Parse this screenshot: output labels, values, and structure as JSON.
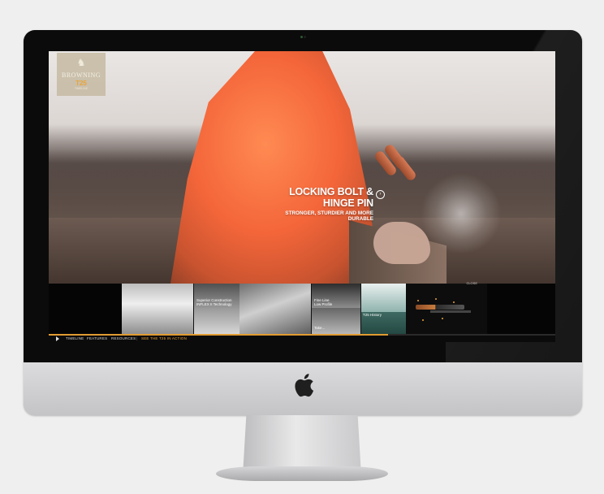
{
  "brand": {
    "name": "BROWNING",
    "model": "T25",
    "tagline": "TIMELINE"
  },
  "hero": {
    "headline": "LOCKING BOLT & HINGE PIN",
    "subhead": "STRONGER, STURDIER AND MORE DURABLE",
    "next_icon": "chevron-right-icon"
  },
  "thumbnails": [
    {
      "caption": ""
    },
    {
      "caption": "Superior Construction\nINFLEX II Technology"
    },
    {
      "caption": ""
    },
    {
      "caption": "Fine Line\nLow Profile"
    },
    {
      "caption": "Take..."
    },
    {
      "caption": "T25 History"
    }
  ],
  "feature_panel": {
    "close_label": "CLOSE"
  },
  "playback": {
    "progress": 0.67
  },
  "nav": {
    "items": [
      "TIMELINE",
      "FEATURES",
      "RESOURCES"
    ],
    "separator": "|",
    "cta": "SEE THE T25 IN ACTION"
  },
  "colors": {
    "accent": "#e19b32",
    "jacket": "#f4663a",
    "bezel": "#0b0b0b"
  }
}
